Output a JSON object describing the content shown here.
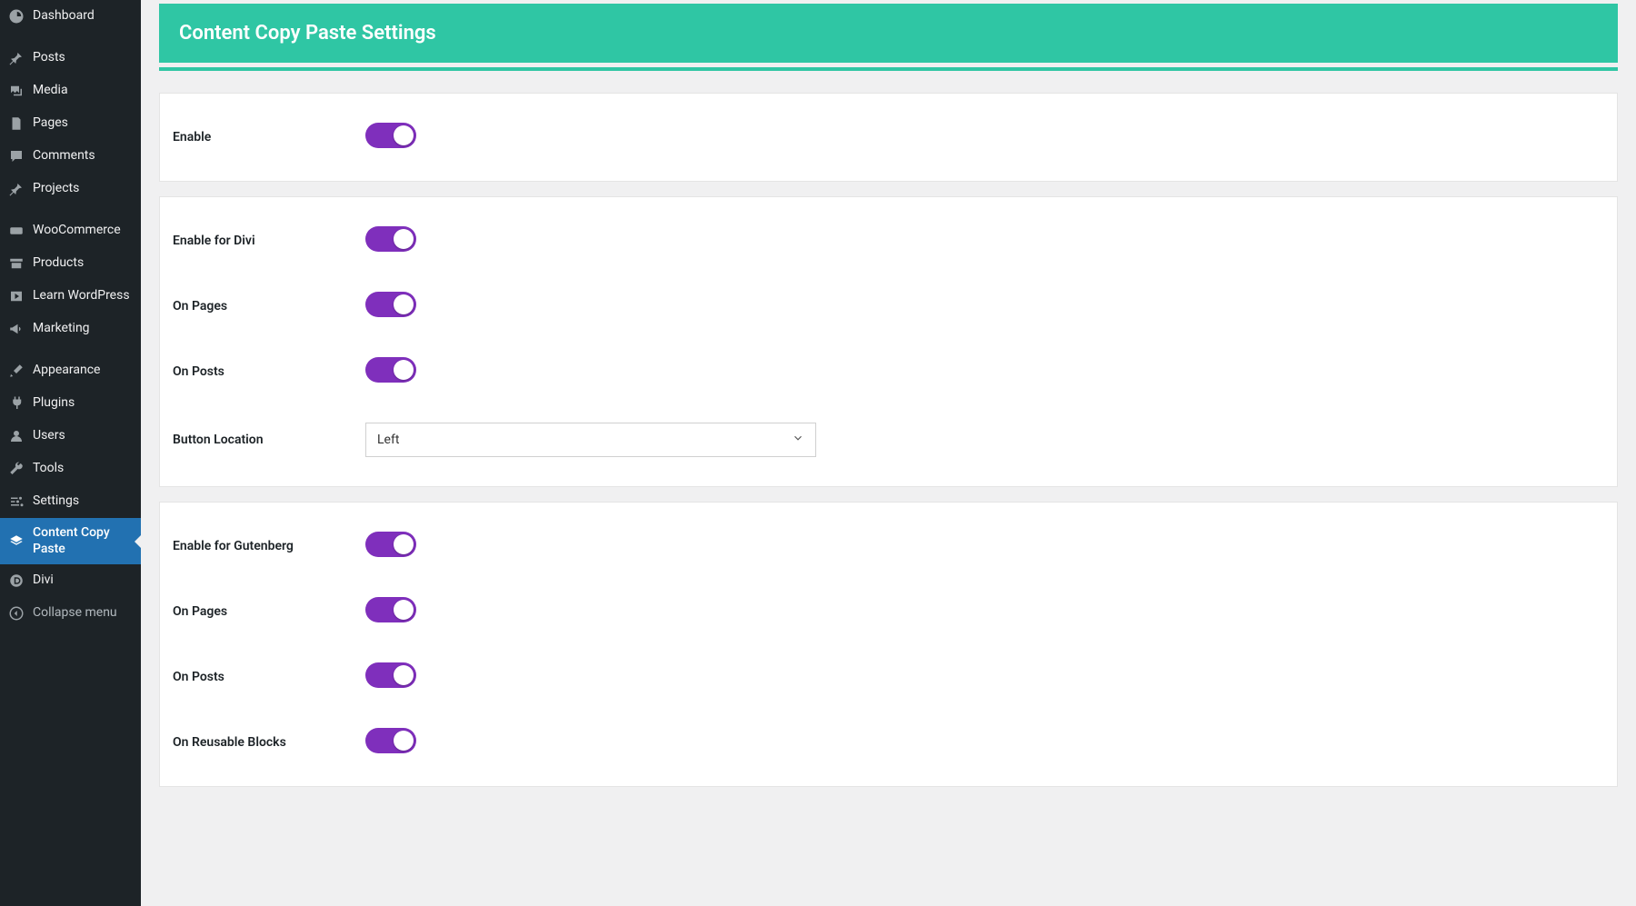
{
  "page": {
    "title": "Content Copy Paste Settings"
  },
  "sidebar": {
    "items": [
      {
        "label": "Dashboard"
      },
      {
        "label": "Posts"
      },
      {
        "label": "Media"
      },
      {
        "label": "Pages"
      },
      {
        "label": "Comments"
      },
      {
        "label": "Projects"
      },
      {
        "label": "WooCommerce"
      },
      {
        "label": "Products"
      },
      {
        "label": "Learn WordPress"
      },
      {
        "label": "Marketing"
      },
      {
        "label": "Appearance"
      },
      {
        "label": "Plugins"
      },
      {
        "label": "Users"
      },
      {
        "label": "Tools"
      },
      {
        "label": "Settings"
      },
      {
        "label": "Content Copy Paste"
      },
      {
        "label": "Divi"
      },
      {
        "label": "Collapse menu"
      }
    ]
  },
  "settings": {
    "general": {
      "enable": {
        "label": "Enable",
        "on": true
      }
    },
    "divi": {
      "enable": {
        "label": "Enable for Divi",
        "on": true
      },
      "pages": {
        "label": "On Pages",
        "on": true
      },
      "posts": {
        "label": "On Posts",
        "on": true
      },
      "button_location": {
        "label": "Button Location",
        "value": "Left"
      }
    },
    "gutenberg": {
      "enable": {
        "label": "Enable for Gutenberg",
        "on": true
      },
      "pages": {
        "label": "On Pages",
        "on": true
      },
      "posts": {
        "label": "On Posts",
        "on": true
      },
      "reusable": {
        "label": "On Reusable Blocks",
        "on": true
      }
    }
  }
}
